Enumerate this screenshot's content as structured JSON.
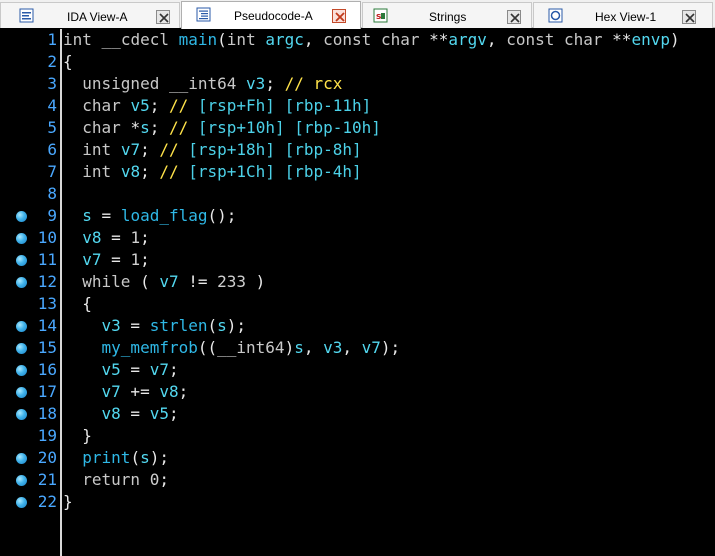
{
  "tabs": [
    {
      "label": "IDA View-A",
      "icon": "ida-view-icon",
      "active": false
    },
    {
      "label": "Pseudocode-A",
      "icon": "pseudocode-icon",
      "active": true
    },
    {
      "label": "Strings",
      "icon": "strings-icon",
      "active": false
    },
    {
      "label": "Hex View-1",
      "icon": "hex-view-icon",
      "active": false
    }
  ],
  "colors": {
    "keyword": "#c8c8c8",
    "identifier": "#53d8f0",
    "function": "#2fb8e6",
    "comment": "#ffe34a",
    "line_number": "#4aa8ff",
    "background": "#000000"
  },
  "code": {
    "lines": [
      {
        "num": "1",
        "bp": false,
        "tokens": [
          [
            "t-kw",
            "int"
          ],
          [
            "t-pl",
            " "
          ],
          [
            "t-kw",
            "__cdecl"
          ],
          [
            "t-pl",
            " "
          ],
          [
            "t-fn",
            "main"
          ],
          [
            "t-pu",
            "("
          ],
          [
            "t-kw",
            "int"
          ],
          [
            "t-pl",
            " "
          ],
          [
            "t-id",
            "argc"
          ],
          [
            "t-pu",
            ", "
          ],
          [
            "t-kw",
            "const"
          ],
          [
            "t-pl",
            " "
          ],
          [
            "t-kw",
            "char"
          ],
          [
            "t-pl",
            " "
          ],
          [
            "t-pu",
            "**"
          ],
          [
            "t-id",
            "argv"
          ],
          [
            "t-pu",
            ", "
          ],
          [
            "t-kw",
            "const"
          ],
          [
            "t-pl",
            " "
          ],
          [
            "t-kw",
            "char"
          ],
          [
            "t-pl",
            " "
          ],
          [
            "t-pu",
            "**"
          ],
          [
            "t-id",
            "envp"
          ],
          [
            "t-pu",
            ")"
          ]
        ]
      },
      {
        "num": "2",
        "bp": false,
        "tokens": [
          [
            "t-pu",
            "{"
          ]
        ]
      },
      {
        "num": "3",
        "bp": false,
        "tokens": [
          [
            "t-pl",
            "  "
          ],
          [
            "t-kw",
            "unsigned"
          ],
          [
            "t-pl",
            " "
          ],
          [
            "t-kw",
            "__int64"
          ],
          [
            "t-pl",
            " "
          ],
          [
            "t-id",
            "v3"
          ],
          [
            "t-pu",
            "; "
          ],
          [
            "t-cm",
            "// rcx"
          ]
        ]
      },
      {
        "num": "4",
        "bp": false,
        "tokens": [
          [
            "t-pl",
            "  "
          ],
          [
            "t-kw",
            "char"
          ],
          [
            "t-pl",
            " "
          ],
          [
            "t-id",
            "v5"
          ],
          [
            "t-pu",
            "; "
          ],
          [
            "t-cm",
            "// "
          ],
          [
            "t-rg",
            "[rsp+Fh] [rbp-11h]"
          ]
        ]
      },
      {
        "num": "5",
        "bp": false,
        "tokens": [
          [
            "t-pl",
            "  "
          ],
          [
            "t-kw",
            "char"
          ],
          [
            "t-pl",
            " "
          ],
          [
            "t-pu",
            "*"
          ],
          [
            "t-id",
            "s"
          ],
          [
            "t-pu",
            "; "
          ],
          [
            "t-cm",
            "// "
          ],
          [
            "t-rg",
            "[rsp+10h] [rbp-10h]"
          ]
        ]
      },
      {
        "num": "6",
        "bp": false,
        "tokens": [
          [
            "t-pl",
            "  "
          ],
          [
            "t-kw",
            "int"
          ],
          [
            "t-pl",
            " "
          ],
          [
            "t-id",
            "v7"
          ],
          [
            "t-pu",
            "; "
          ],
          [
            "t-cm",
            "// "
          ],
          [
            "t-rg",
            "[rsp+18h] [rbp-8h]"
          ]
        ]
      },
      {
        "num": "7",
        "bp": false,
        "tokens": [
          [
            "t-pl",
            "  "
          ],
          [
            "t-kw",
            "int"
          ],
          [
            "t-pl",
            " "
          ],
          [
            "t-id",
            "v8"
          ],
          [
            "t-pu",
            "; "
          ],
          [
            "t-cm",
            "// "
          ],
          [
            "t-rg",
            "[rsp+1Ch] [rbp-4h]"
          ]
        ]
      },
      {
        "num": "8",
        "bp": false,
        "tokens": []
      },
      {
        "num": "9",
        "bp": true,
        "tokens": [
          [
            "t-pl",
            "  "
          ],
          [
            "t-id",
            "s"
          ],
          [
            "t-pu",
            " = "
          ],
          [
            "t-fn",
            "load_flag"
          ],
          [
            "t-pu",
            "();"
          ]
        ]
      },
      {
        "num": "10",
        "bp": true,
        "tokens": [
          [
            "t-pl",
            "  "
          ],
          [
            "t-id",
            "v8"
          ],
          [
            "t-pu",
            " = "
          ],
          [
            "t-pl",
            "1"
          ],
          [
            "t-pu",
            ";"
          ]
        ]
      },
      {
        "num": "11",
        "bp": true,
        "tokens": [
          [
            "t-pl",
            "  "
          ],
          [
            "t-id",
            "v7"
          ],
          [
            "t-pu",
            " = "
          ],
          [
            "t-pl",
            "1"
          ],
          [
            "t-pu",
            ";"
          ]
        ]
      },
      {
        "num": "12",
        "bp": true,
        "tokens": [
          [
            "t-pl",
            "  "
          ],
          [
            "t-kw",
            "while"
          ],
          [
            "t-pu",
            " ( "
          ],
          [
            "t-id",
            "v7"
          ],
          [
            "t-pu",
            " != "
          ],
          [
            "t-pl",
            "233"
          ],
          [
            "t-pu",
            " )"
          ]
        ]
      },
      {
        "num": "13",
        "bp": false,
        "tokens": [
          [
            "t-pl",
            "  "
          ],
          [
            "t-pu",
            "{"
          ]
        ]
      },
      {
        "num": "14",
        "bp": true,
        "tokens": [
          [
            "t-pl",
            "    "
          ],
          [
            "t-id",
            "v3"
          ],
          [
            "t-pu",
            " = "
          ],
          [
            "t-fn",
            "strlen"
          ],
          [
            "t-pu",
            "("
          ],
          [
            "t-id",
            "s"
          ],
          [
            "t-pu",
            ");"
          ]
        ]
      },
      {
        "num": "15",
        "bp": true,
        "tokens": [
          [
            "t-pl",
            "    "
          ],
          [
            "t-fn",
            "my_memfrob"
          ],
          [
            "t-pu",
            "(("
          ],
          [
            "t-kw",
            "__int64"
          ],
          [
            "t-pu",
            ")"
          ],
          [
            "t-id",
            "s"
          ],
          [
            "t-pu",
            ", "
          ],
          [
            "t-id",
            "v3"
          ],
          [
            "t-pu",
            ", "
          ],
          [
            "t-id",
            "v7"
          ],
          [
            "t-pu",
            ");"
          ]
        ]
      },
      {
        "num": "16",
        "bp": true,
        "tokens": [
          [
            "t-pl",
            "    "
          ],
          [
            "t-id",
            "v5"
          ],
          [
            "t-pu",
            " = "
          ],
          [
            "t-id",
            "v7"
          ],
          [
            "t-pu",
            ";"
          ]
        ]
      },
      {
        "num": "17",
        "bp": true,
        "tokens": [
          [
            "t-pl",
            "    "
          ],
          [
            "t-id",
            "v7"
          ],
          [
            "t-pu",
            " += "
          ],
          [
            "t-id",
            "v8"
          ],
          [
            "t-pu",
            ";"
          ]
        ]
      },
      {
        "num": "18",
        "bp": true,
        "tokens": [
          [
            "t-pl",
            "    "
          ],
          [
            "t-id",
            "v8"
          ],
          [
            "t-pu",
            " = "
          ],
          [
            "t-id",
            "v5"
          ],
          [
            "t-pu",
            ";"
          ]
        ]
      },
      {
        "num": "19",
        "bp": false,
        "tokens": [
          [
            "t-pl",
            "  "
          ],
          [
            "t-pu",
            "}"
          ]
        ]
      },
      {
        "num": "20",
        "bp": true,
        "tokens": [
          [
            "t-pl",
            "  "
          ],
          [
            "t-fn",
            "print"
          ],
          [
            "t-pu",
            "("
          ],
          [
            "t-id",
            "s"
          ],
          [
            "t-pu",
            ");"
          ]
        ]
      },
      {
        "num": "21",
        "bp": true,
        "tokens": [
          [
            "t-pl",
            "  "
          ],
          [
            "t-kw",
            "return"
          ],
          [
            "t-pl",
            " 0"
          ],
          [
            "t-pu",
            ";"
          ]
        ]
      },
      {
        "num": "22",
        "bp": true,
        "tokens": [
          [
            "t-pu",
            "}"
          ]
        ]
      }
    ]
  }
}
